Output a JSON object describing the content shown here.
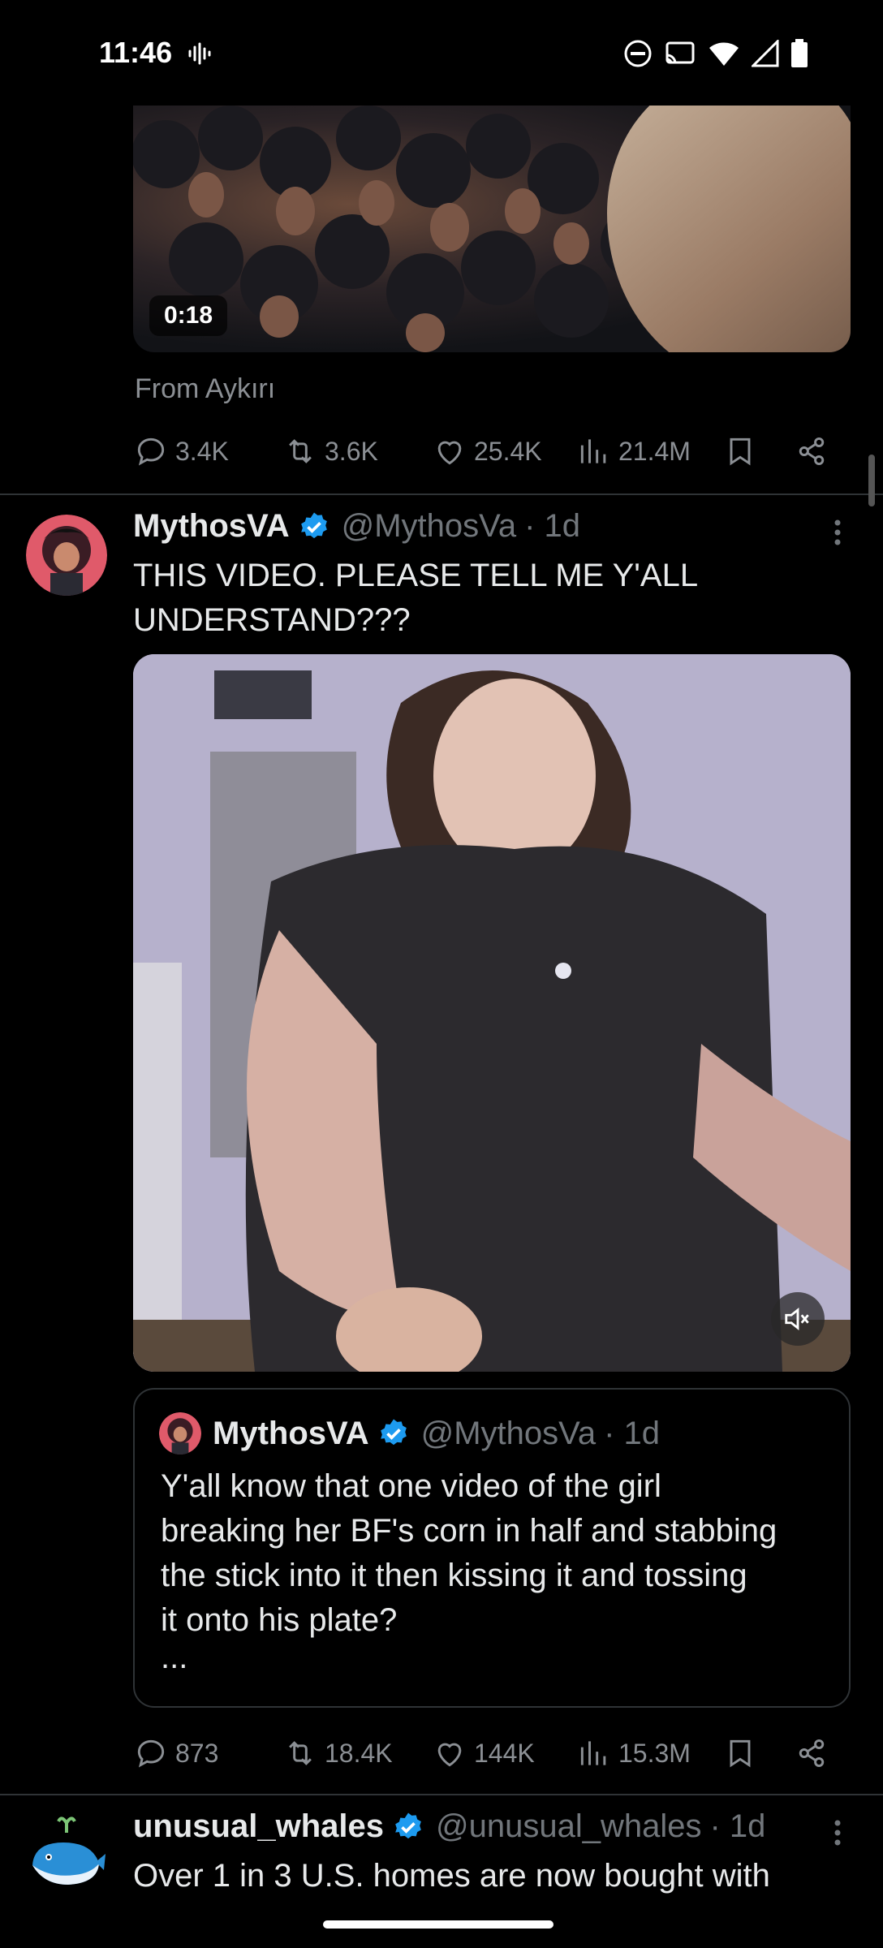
{
  "status_bar": {
    "time": "11:46",
    "icons": [
      "voice-icon",
      "dnd-icon",
      "cast-icon",
      "wifi-icon",
      "signal-icon",
      "battery-icon"
    ]
  },
  "previous_tweet": {
    "video_duration": "0:18",
    "source_line": "From Aykırı",
    "actions": {
      "replies": "3.4K",
      "reposts": "3.6K",
      "likes": "25.4K",
      "views": "21.4M"
    }
  },
  "tweet_1": {
    "name": "MythosVA",
    "handle": "@MythosVa",
    "time": "· 1d",
    "text_line1": "THIS VIDEO. PLEASE TELL ME Y'ALL",
    "text_line2": "UNDERSTAND???",
    "quote": {
      "name": "MythosVA",
      "handle": "@MythosVa",
      "time": "· 1d",
      "lines": [
        "Y'all know that one video of the girl",
        "breaking her BF's corn in half and stabbing",
        "the stick into it then kissing it and tossing",
        "it onto his plate?"
      ],
      "ellipsis": "..."
    },
    "actions": {
      "replies": "873",
      "reposts": "18.4K",
      "likes": "144K",
      "views": "15.3M"
    }
  },
  "tweet_2": {
    "name": "unusual_whales",
    "handle": "@unusual_whales",
    "time": "· 1d",
    "text_line1": "Over 1 in 3 U.S. homes are now bought with"
  },
  "colors": {
    "verified": "#1d9bf0",
    "muted_text": "#71767b",
    "divider": "#2f3336"
  }
}
